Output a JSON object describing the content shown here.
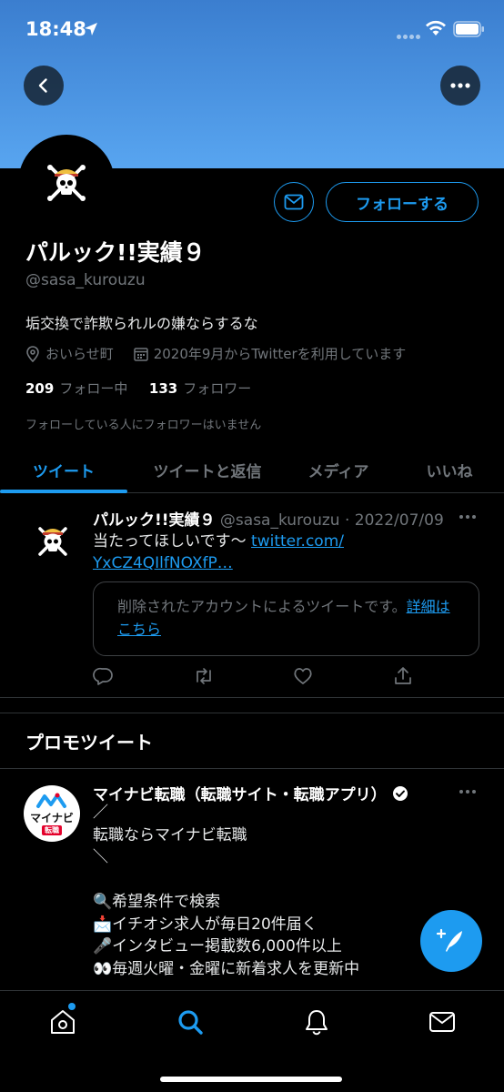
{
  "status_bar": {
    "time": "18:48"
  },
  "profile": {
    "name": "パルック!!実績９",
    "handle": "@sasa_kurouzu",
    "bio": "垢交換で詐欺られルの嫌ならするな",
    "location": "おいらせ町",
    "joined": "2020年9月からTwitterを利用しています",
    "following_count": "209",
    "following_label": "フォロー中",
    "followers_count": "133",
    "followers_label": "フォロワー",
    "no_followers_note": "フォローしている人にフォロワーはいません",
    "follow_button": "フォローする"
  },
  "tabs": [
    {
      "label": "ツイート",
      "active": true
    },
    {
      "label": "ツイートと返信",
      "active": false
    },
    {
      "label": "メディア",
      "active": false
    },
    {
      "label": "いいね",
      "active": false
    }
  ],
  "tweet": {
    "author_name": "パルック!!実績９",
    "author_handle": "@sasa_kurouzu",
    "date": "· 2022/07/09",
    "text": "当たってほしいです～ ",
    "link_line1": "twitter.com/",
    "link_line2": "YxCZ4QIlfNOXfP…",
    "deleted_notice": "削除されたアカウントによるツイートです。",
    "deleted_link": "詳細はこちら"
  },
  "promo": {
    "section_title": "プロモツイート",
    "avatar_text": "マイナビ",
    "avatar_badge": "転職",
    "author_name": "マイナビ転職（転職サイト・転職アプリ）",
    "lines": [
      "／",
      "転職ならマイナビ転職",
      "＼",
      "",
      "🔍希望条件で検索",
      "📩イチオシ求人が毎日20件届く",
      "🎤インタビュー掲載数6,000件以上",
      "👀毎週火曜・金曜に新着求人を更新中"
    ]
  },
  "colors": {
    "accent": "#1d9bf0",
    "banner_top": "#3b7ecf",
    "banner_bottom": "#58a5f0",
    "background": "#000000",
    "muted_text": "#71767b"
  },
  "icons": {
    "nav": [
      "home-icon",
      "search-icon",
      "bell-icon",
      "mail-icon"
    ],
    "tweet_actions": [
      "reply-icon",
      "retweet-icon",
      "like-icon",
      "share-icon"
    ]
  }
}
